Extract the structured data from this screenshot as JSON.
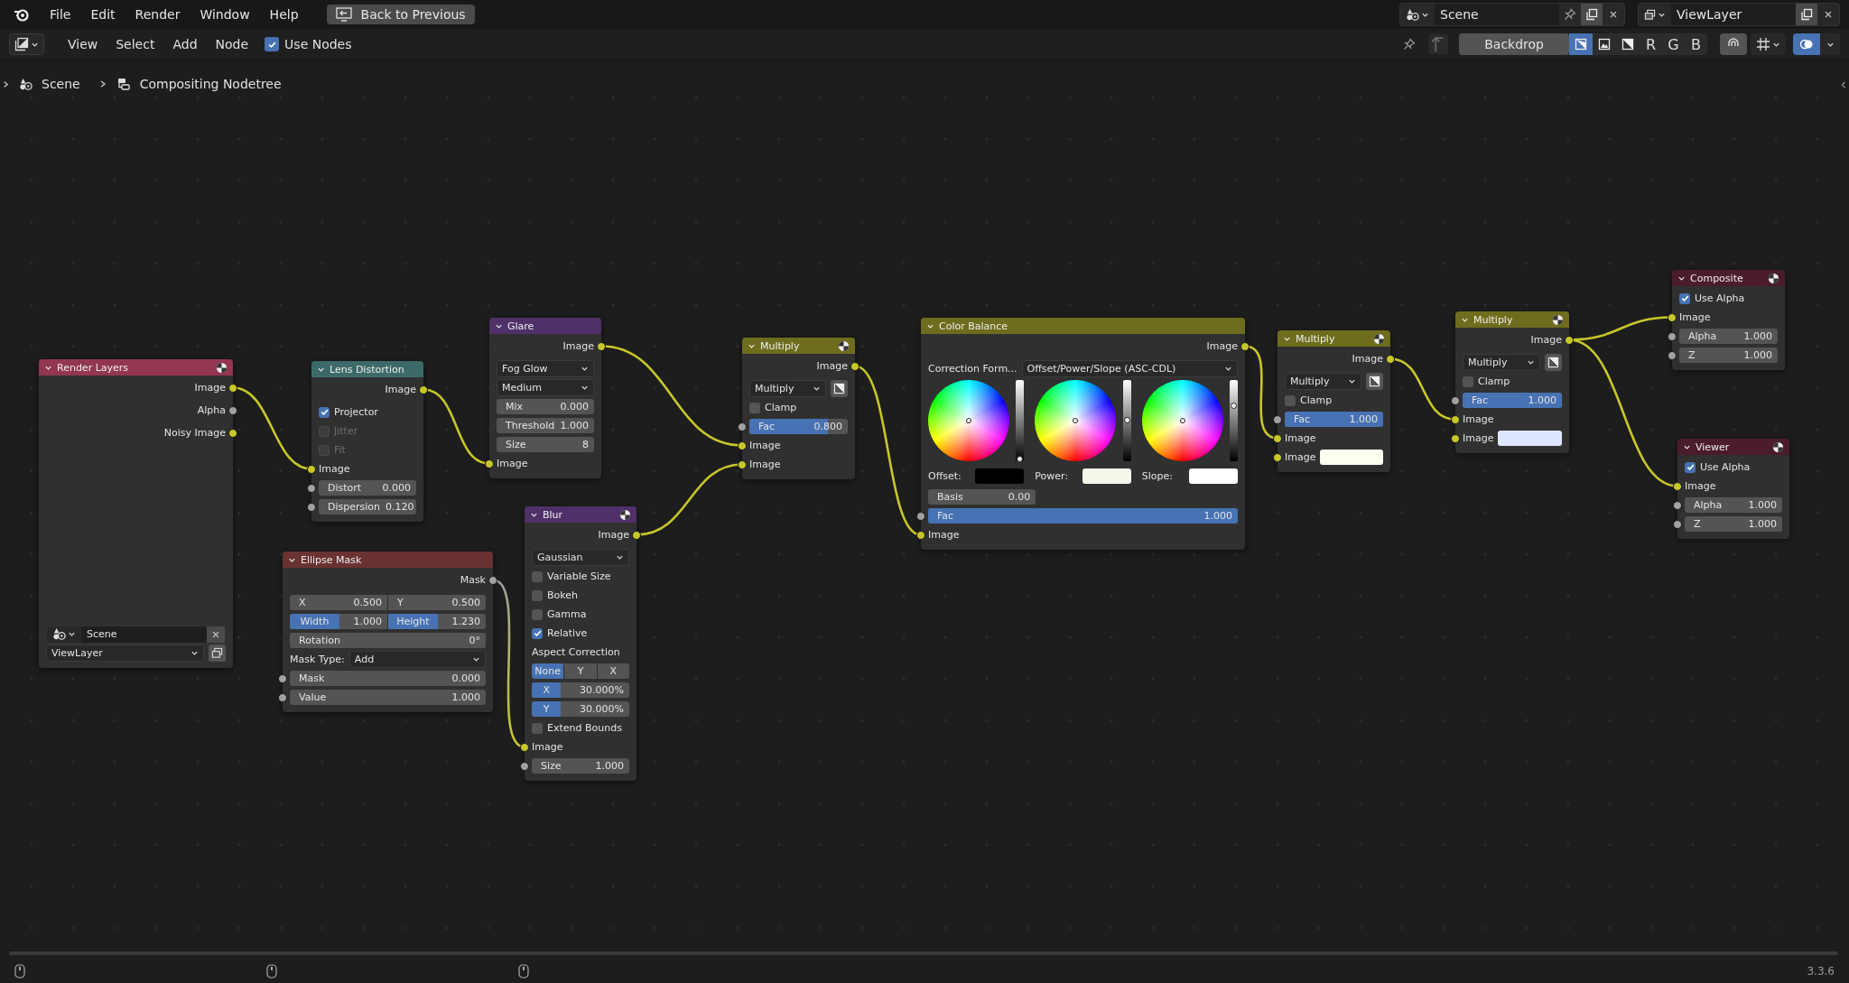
{
  "top_bar": {
    "menus": [
      "File",
      "Edit",
      "Render",
      "Window",
      "Help"
    ],
    "back_button": "Back to Previous",
    "scene": "Scene",
    "view_layer": "ViewLayer"
  },
  "header": {
    "menus": [
      "View",
      "Select",
      "Add",
      "Node"
    ],
    "use_nodes": {
      "label": "Use Nodes",
      "checked": true
    },
    "backdrop": "Backdrop",
    "backdrop_modes": [
      {
        "selected": true
      },
      {
        "selected": false
      },
      {
        "selected": false
      }
    ],
    "channels": [
      {
        "label": "R",
        "selected": false
      },
      {
        "label": "G",
        "selected": false
      },
      {
        "label": "B",
        "selected": false
      }
    ],
    "overlays": {
      "selected": true
    }
  },
  "breadcrumb": [
    "Scene",
    "Compositing Nodetree"
  ],
  "nodes": [
    {
      "title": "Render Layers",
      "color": "#923652",
      "preview": true,
      "rows": [
        {
          "kind": "output",
          "label": "Image",
          "socket": {
            "color": "#c7c729"
          }
        },
        {
          "kind": "output",
          "label": "Alpha",
          "socket": {
            "color": "#a1a1a1"
          }
        },
        {
          "kind": "output",
          "label": "Noisy Image",
          "socket": {
            "color": "#c7c729"
          }
        },
        {
          "kind": "datablock",
          "value": "Scene"
        },
        {
          "kind": "dropdown",
          "value": "ViewLayer",
          "icon_button": true
        }
      ]
    },
    {
      "title": "Lens Distortion",
      "color": "#3c6a68",
      "preview": false,
      "rows": [
        {
          "kind": "output",
          "label": "Image",
          "socket": {
            "color": "#c7c729"
          }
        },
        {
          "kind": "checkbox",
          "label": "Projector",
          "checked": true,
          "disabled": false
        },
        {
          "kind": "checkbox",
          "label": "Jitter",
          "checked": false,
          "disabled": true
        },
        {
          "kind": "checkbox",
          "label": "Fit",
          "checked": false,
          "disabled": true
        },
        {
          "kind": "input",
          "label": "Image",
          "socket": {
            "color": "#c7c729"
          }
        },
        {
          "kind": "field",
          "label": "Distort",
          "value": "0.000",
          "socket": {
            "color": "#a1a1a1"
          }
        },
        {
          "kind": "field",
          "label": "Dispersion",
          "value": "0.120",
          "socket": {
            "color": "#a1a1a1"
          }
        }
      ]
    },
    {
      "title": "Glare",
      "color": "#4f3068",
      "preview": false,
      "rows": [
        {
          "kind": "output",
          "label": "Image",
          "socket": {
            "color": "#c7c729"
          }
        },
        {
          "kind": "dropdown",
          "value": "Fog Glow"
        },
        {
          "kind": "dropdown",
          "value": "Medium"
        },
        {
          "kind": "field",
          "label": "Mix",
          "value": "0.000"
        },
        {
          "kind": "field",
          "label": "Threshold",
          "value": "1.000"
        },
        {
          "kind": "field",
          "label": "Size",
          "value": "8"
        },
        {
          "kind": "input",
          "label": "Image",
          "socket": {
            "color": "#c7c729"
          }
        }
      ]
    },
    {
      "title": "Ellipse Mask",
      "color": "#6a3232",
      "preview": false,
      "rows": [
        {
          "kind": "output",
          "label": "Mask",
          "socket": {
            "color": "#a1a1a1"
          }
        },
        {
          "kind": "pair",
          "parts": [
            {
              "label": "X",
              "value": "0.500",
              "highlighted": false
            },
            {
              "label": "Y",
              "value": "0.500",
              "highlighted": false
            }
          ]
        },
        {
          "kind": "pair",
          "parts": [
            {
              "label": "Width",
              "value": "1.000",
              "highlighted": true
            },
            {
              "label": "Height",
              "value": "1.230",
              "highlighted": true
            }
          ]
        },
        {
          "kind": "field",
          "label": "Rotation",
          "value": "0°"
        },
        {
          "kind": "dropdown",
          "label": "Mask Type:",
          "value": "Add"
        },
        {
          "kind": "field",
          "label": "Mask",
          "value": "0.000",
          "socket": {
            "color": "#a1a1a1"
          }
        },
        {
          "kind": "field",
          "label": "Value",
          "value": "1.000",
          "socket": {
            "color": "#a1a1a1"
          }
        }
      ]
    },
    {
      "title": "Blur",
      "color": "#4f3068",
      "preview": true,
      "rows": [
        {
          "kind": "output",
          "label": "Image",
          "socket": {
            "color": "#c7c729"
          }
        },
        {
          "kind": "dropdown",
          "value": "Gaussian"
        },
        {
          "kind": "checkbox",
          "label": "Variable Size",
          "checked": false,
          "disabled": false
        },
        {
          "kind": "checkbox",
          "label": "Bokeh",
          "checked": false,
          "disabled": false
        },
        {
          "kind": "checkbox",
          "label": "Gamma",
          "checked": false,
          "disabled": false
        },
        {
          "kind": "checkbox",
          "label": "Relative",
          "checked": true,
          "disabled": false
        },
        {
          "kind": "label",
          "label": "Aspect Correction"
        },
        {
          "kind": "segmented",
          "options": [
            {
              "label": "None",
              "selected": true
            },
            {
              "label": "Y",
              "selected": false
            },
            {
              "label": "X",
              "selected": false
            }
          ]
        },
        {
          "kind": "field",
          "label": "X",
          "value": "30.000%",
          "highlighted": true
        },
        {
          "kind": "field",
          "label": "Y",
          "value": "30.000%",
          "highlighted": true
        },
        {
          "kind": "checkbox",
          "label": "Extend Bounds",
          "checked": false,
          "disabled": false
        },
        {
          "kind": "input",
          "label": "Image",
          "socket": {
            "color": "#c7c729"
          }
        },
        {
          "kind": "field",
          "label": "Size",
          "value": "1.000",
          "socket": {
            "color": "#a1a1a1"
          }
        }
      ]
    },
    {
      "title": "Multiply",
      "color": "#6e6d1d",
      "preview": true,
      "rows": [
        {
          "kind": "output",
          "label": "Image",
          "socket": {
            "color": "#c7c729"
          }
        },
        {
          "kind": "dropdown",
          "value": "Multiply",
          "icon_button": true
        },
        {
          "kind": "checkbox",
          "label": "Clamp",
          "checked": false,
          "disabled": false
        },
        {
          "kind": "field",
          "label": "Fac",
          "value": "0.800",
          "socket": {
            "color": "#a1a1a1"
          },
          "level": 0.8
        },
        {
          "kind": "input",
          "label": "Image",
          "socket": {
            "color": "#c7c729"
          }
        },
        {
          "kind": "input",
          "label": "Image",
          "socket": {
            "color": "#c7c729"
          }
        }
      ]
    },
    {
      "title": "Color Balance",
      "color": "#6e6d1d",
      "preview": false,
      "rows": [
        {
          "kind": "output",
          "label": "Image",
          "socket": {
            "color": "#c7c729"
          }
        },
        {
          "kind": "dropdown",
          "label": "Correction Form...",
          "value": "Offset/Power/Slope (ASC-CDL)"
        },
        {
          "kind": "wheels",
          "wheels": [
            {
              "label": "Offset:",
              "color": "#000000",
              "level": 0.02
            },
            {
              "label": "Power:",
              "color": "#f3f8ea",
              "level": 0.5
            },
            {
              "label": "Slope:",
              "color": "#ffffff",
              "level": 0.68
            }
          ]
        },
        {
          "kind": "short-field",
          "label": "Basis",
          "value": "0.00"
        },
        {
          "kind": "field",
          "label": "Fac",
          "value": "1.000",
          "socket": {
            "color": "#a1a1a1"
          },
          "level": 1
        },
        {
          "kind": "input",
          "label": "Image",
          "socket": {
            "color": "#c7c729"
          }
        }
      ]
    },
    {
      "title": "Multiply",
      "color": "#6e6d1d",
      "preview": true,
      "rows": [
        {
          "kind": "output",
          "label": "Image",
          "socket": {
            "color": "#c7c729"
          }
        },
        {
          "kind": "dropdown",
          "value": "Multiply",
          "icon_button": true
        },
        {
          "kind": "checkbox",
          "label": "Clamp",
          "checked": false,
          "disabled": false
        },
        {
          "kind": "field",
          "label": "Fac",
          "value": "1.000",
          "socket": {
            "color": "#a1a1a1"
          },
          "level": 1
        },
        {
          "kind": "input",
          "label": "Image",
          "socket": {
            "color": "#c7c729"
          }
        },
        {
          "kind": "color-input",
          "label": "Image",
          "socket": {
            "color": "#c7c729"
          },
          "color": "#fffff2"
        }
      ]
    },
    {
      "title": "Multiply",
      "color": "#6e6d1d",
      "preview": true,
      "rows": [
        {
          "kind": "output",
          "label": "Image",
          "socket": {
            "color": "#c7c729"
          }
        },
        {
          "kind": "dropdown",
          "value": "Multiply",
          "icon_button": true
        },
        {
          "kind": "checkbox",
          "label": "Clamp",
          "checked": false,
          "disabled": false
        },
        {
          "kind": "field",
          "label": "Fac",
          "value": "1.000",
          "socket": {
            "color": "#a1a1a1"
          },
          "level": 1
        },
        {
          "kind": "input",
          "label": "Image",
          "socket": {
            "color": "#c7c729"
          }
        },
        {
          "kind": "color-input",
          "label": "Image",
          "socket": {
            "color": "#c7c729"
          },
          "color": "#dde7ff"
        }
      ]
    },
    {
      "title": "Composite",
      "color": "#4b1c2a",
      "preview": true,
      "rows": [
        {
          "kind": "checkbox",
          "label": "Use Alpha",
          "checked": true,
          "disabled": false
        },
        {
          "kind": "input",
          "label": "Image",
          "socket": {
            "color": "#c7c729"
          }
        },
        {
          "kind": "field",
          "label": "Alpha",
          "value": "1.000",
          "socket": {
            "color": "#a1a1a1"
          }
        },
        {
          "kind": "field",
          "label": "Z",
          "value": "1.000",
          "socket": {
            "color": "#a1a1a1"
          }
        }
      ]
    },
    {
      "title": "Viewer",
      "color": "#4b1c2a",
      "preview": true,
      "rows": [
        {
          "kind": "checkbox",
          "label": "Use Alpha",
          "checked": true,
          "disabled": false
        },
        {
          "kind": "input",
          "label": "Image",
          "socket": {
            "color": "#c7c729"
          }
        },
        {
          "kind": "field",
          "label": "Alpha",
          "value": "1.000",
          "socket": {
            "color": "#a1a1a1"
          }
        },
        {
          "kind": "field",
          "label": "Z",
          "value": "1.000",
          "socket": {
            "color": "#a1a1a1"
          }
        }
      ]
    }
  ],
  "status_bar": {
    "version": "3.3.6"
  }
}
